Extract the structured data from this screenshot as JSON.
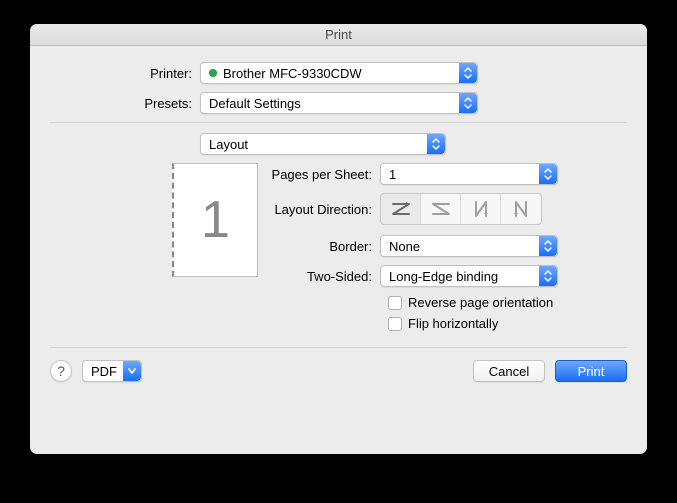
{
  "window": {
    "title": "Print"
  },
  "labels": {
    "printer": "Printer:",
    "presets": "Presets:",
    "pages_per_sheet": "Pages per Sheet:",
    "layout_direction": "Layout Direction:",
    "border": "Border:",
    "two_sided": "Two-Sided:"
  },
  "values": {
    "printer": "Brother MFC-9330CDW",
    "presets": "Default Settings",
    "section": "Layout",
    "pages_per_sheet": "1",
    "border": "None",
    "two_sided": "Long-Edge binding",
    "preview_page_count": "1"
  },
  "checks": {
    "reverse": "Reverse page orientation",
    "flip": "Flip horizontally"
  },
  "footer": {
    "help": "?",
    "pdf": "PDF",
    "cancel": "Cancel",
    "print": "Print"
  }
}
